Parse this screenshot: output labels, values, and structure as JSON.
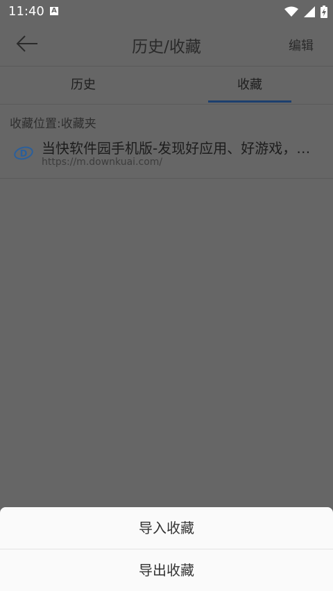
{
  "status_bar": {
    "time": "11:40",
    "notification_glyph": "A"
  },
  "app_bar": {
    "title": "历史/收藏",
    "edit_label": "编辑"
  },
  "tabs": [
    {
      "label": "历史",
      "selected": false
    },
    {
      "label": "收藏",
      "selected": true
    }
  ],
  "bookmarks": {
    "location_label": "收藏位置:收藏夹",
    "items": [
      {
        "title": "当快软件园手机版-发现好应用、好游戏，…",
        "url": "https://m.downkuai.com/",
        "icon": "downkuai-logo-icon"
      }
    ]
  },
  "bottom_sheet": {
    "import_label": "导入收藏",
    "export_label": "导出收藏"
  },
  "colors": {
    "accent": "#1c3f6e",
    "scrim": "#666666",
    "sheet": "#fafafa"
  }
}
